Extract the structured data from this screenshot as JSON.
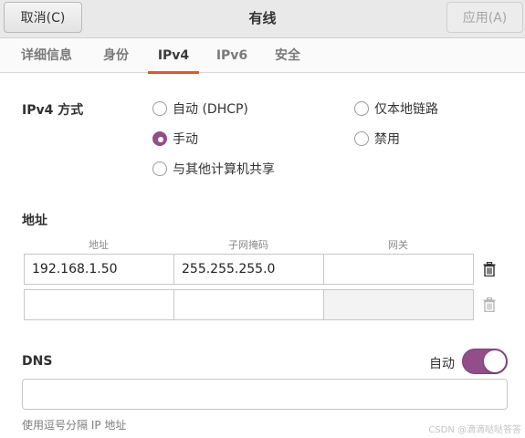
{
  "header": {
    "cancel_label": "取消(C)",
    "title": "有线",
    "apply_label": "应用(A)"
  },
  "tabs": [
    {
      "label": "详细信息"
    },
    {
      "label": "身份"
    },
    {
      "label": "IPv4",
      "active": true
    },
    {
      "label": "IPv6"
    },
    {
      "label": "安全"
    }
  ],
  "method": {
    "label": "IPv4 方式",
    "options": [
      {
        "label": "自动 (DHCP)",
        "checked": false
      },
      {
        "label": "手动",
        "checked": true
      },
      {
        "label": "与其他计算机共享",
        "checked": false
      },
      {
        "label": "仅本地链路",
        "checked": false
      },
      {
        "label": "禁用",
        "checked": false
      }
    ]
  },
  "addresses": {
    "label": "地址",
    "columns": [
      "地址",
      "子网掩码",
      "网关"
    ],
    "rows": [
      [
        "192.168.1.50",
        "255.255.255.0",
        ""
      ],
      [
        "",
        "",
        ""
      ]
    ]
  },
  "dns": {
    "label": "DNS",
    "auto_label": "自动",
    "auto_enabled": true,
    "value": "",
    "hint": "使用逗号分隔 IP 地址"
  },
  "colors": {
    "accent": "#924d8b",
    "tab_indicator": "#e95420"
  },
  "watermark": "CSDN @滴滴哒哒答答"
}
